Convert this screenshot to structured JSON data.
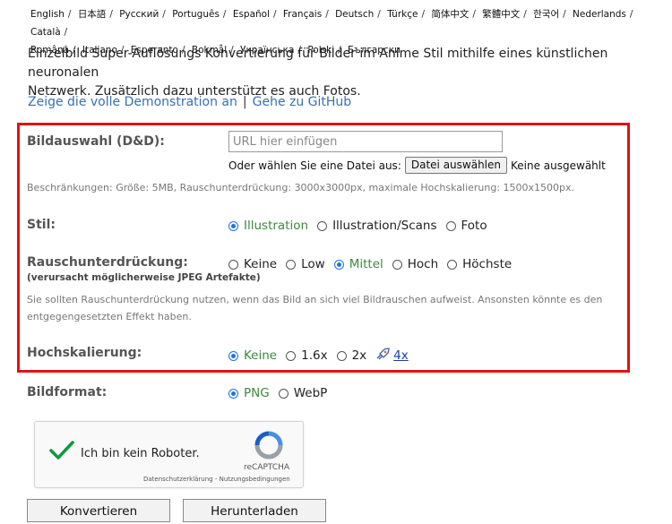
{
  "languages": [
    "English",
    "日本語",
    "Русский",
    "Português",
    "Español",
    "Français",
    "Deutsch",
    "Türkçe",
    "简体中文",
    "繁體中文",
    "한국어",
    "Nederlands",
    "Català",
    "Română",
    "Italiano",
    "Esperanto",
    "Bokmål",
    "Українська",
    "Polski",
    "Български"
  ],
  "intro": {
    "line1": "Einzelbild Super-Auflösungs Konvertierung für Bilder im Anime Stil mithilfe eines künstlichen neuronalen",
    "line2": "Netzwerk. Zusätzlich dazu unterstützt es auch Fotos."
  },
  "links": {
    "demo": "Zeige die volle Demonstration an",
    "separator": "|",
    "github": "Gehe zu GitHub"
  },
  "image_select": {
    "label": "Bildauswahl (D&D):",
    "placeholder": "URL hier einfügen",
    "or_choose": "Oder wählen Sie eine Datei aus:",
    "file_button": "Datei auswählen",
    "no_file": "Keine ausgewählt",
    "limits": "Beschränkungen: Größe: 5MB, Rauschunterdrückung: 3000x3000px, maximale Hochskalierung: 1500x1500px."
  },
  "style": {
    "label": "Stil:",
    "options": [
      "Illustration",
      "Illustration/Scans",
      "Foto"
    ],
    "selected": "Illustration"
  },
  "noise": {
    "label": "Rauschunterdrückung:",
    "sublabel": "(verursacht möglicherweise JPEG Artefakte)",
    "options": [
      "Keine",
      "Low",
      "Mittel",
      "Hoch",
      "Höchste"
    ],
    "selected": "Mittel",
    "note1": "Sie sollten Rauschunterdrückung nutzen, wenn das Bild an sich viel Bildrauschen aufweist. Ansonsten könnte es den",
    "note2": "entgegengesetzten Effekt haben."
  },
  "scale": {
    "label": "Hochskalierung:",
    "options": [
      "Keine",
      "1.6x",
      "2x"
    ],
    "selected": "Keine",
    "link_4x": "4x"
  },
  "format": {
    "label": "Bildformat:",
    "options": [
      "PNG",
      "WebP"
    ],
    "selected": "PNG"
  },
  "captcha": {
    "text": "Ich bin kein Roboter.",
    "brand": "reCAPTCHA",
    "legal": "Datenschutzerklärung - Nutzungsbedingungen"
  },
  "buttons": {
    "convert": "Konvertieren",
    "download": "Herunterladen"
  },
  "colors": {
    "frame": "#e01212",
    "selected_text": "#3d8a3d",
    "link": "#3a6fb0",
    "check": "#0a9a3d"
  }
}
